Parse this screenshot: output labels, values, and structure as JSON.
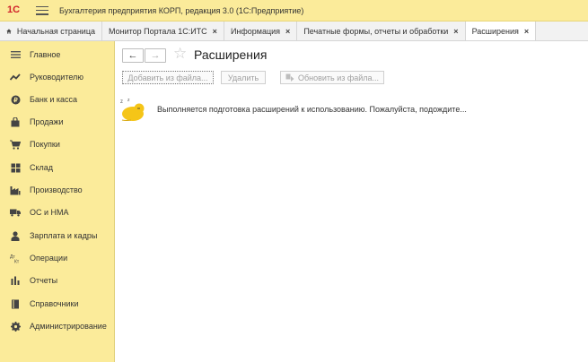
{
  "titlebar": {
    "logo": "1С",
    "app_title": "Бухгалтерия предприятия КОРП, редакция 3.0  (1С:Предприятие)"
  },
  "tabs": [
    {
      "label": "Начальная страница",
      "icon": "home-icon",
      "closable": false
    },
    {
      "label": "Монитор Портала 1С:ИТС",
      "closable": true
    },
    {
      "label": "Информация",
      "closable": true
    },
    {
      "label": "Печатные формы, отчеты и обработки",
      "closable": true
    },
    {
      "label": "Расширения",
      "closable": true,
      "active": true
    }
  ],
  "tab_close_glyph": "×",
  "sidebar": {
    "items": [
      {
        "label": "Главное",
        "icon": "menu-lines-icon"
      },
      {
        "label": "Руководителю",
        "icon": "trend-icon"
      },
      {
        "label": "Банк и касса",
        "icon": "coin-icon"
      },
      {
        "label": "Продажи",
        "icon": "bag-icon"
      },
      {
        "label": "Покупки",
        "icon": "cart-icon"
      },
      {
        "label": "Склад",
        "icon": "warehouse-icon"
      },
      {
        "label": "Производство",
        "icon": "factory-icon"
      },
      {
        "label": "ОС и НМА",
        "icon": "truck-icon"
      },
      {
        "label": "Зарплата и кадры",
        "icon": "person-icon"
      },
      {
        "label": "Операции",
        "icon": "operations-icon"
      },
      {
        "label": "Отчеты",
        "icon": "bar-chart-icon"
      },
      {
        "label": "Справочники",
        "icon": "book-icon"
      },
      {
        "label": "Администрирование",
        "icon": "gear-icon"
      }
    ]
  },
  "page": {
    "back_glyph": "←",
    "forward_glyph": "→",
    "star_glyph": "☆",
    "title": "Расширения",
    "buttons": {
      "add_from_file": "Добавить из файла...",
      "delete": "Удалить",
      "update_from_file": "Обновить из файла..."
    },
    "status_message": "Выполняется подготовка расширений к использованию. Пожалуйста, подождите..."
  },
  "colors": {
    "panel_yellow": "#fbeb9a",
    "logo_red": "#d0202a",
    "wait_icon_yellow": "#f5c518"
  }
}
